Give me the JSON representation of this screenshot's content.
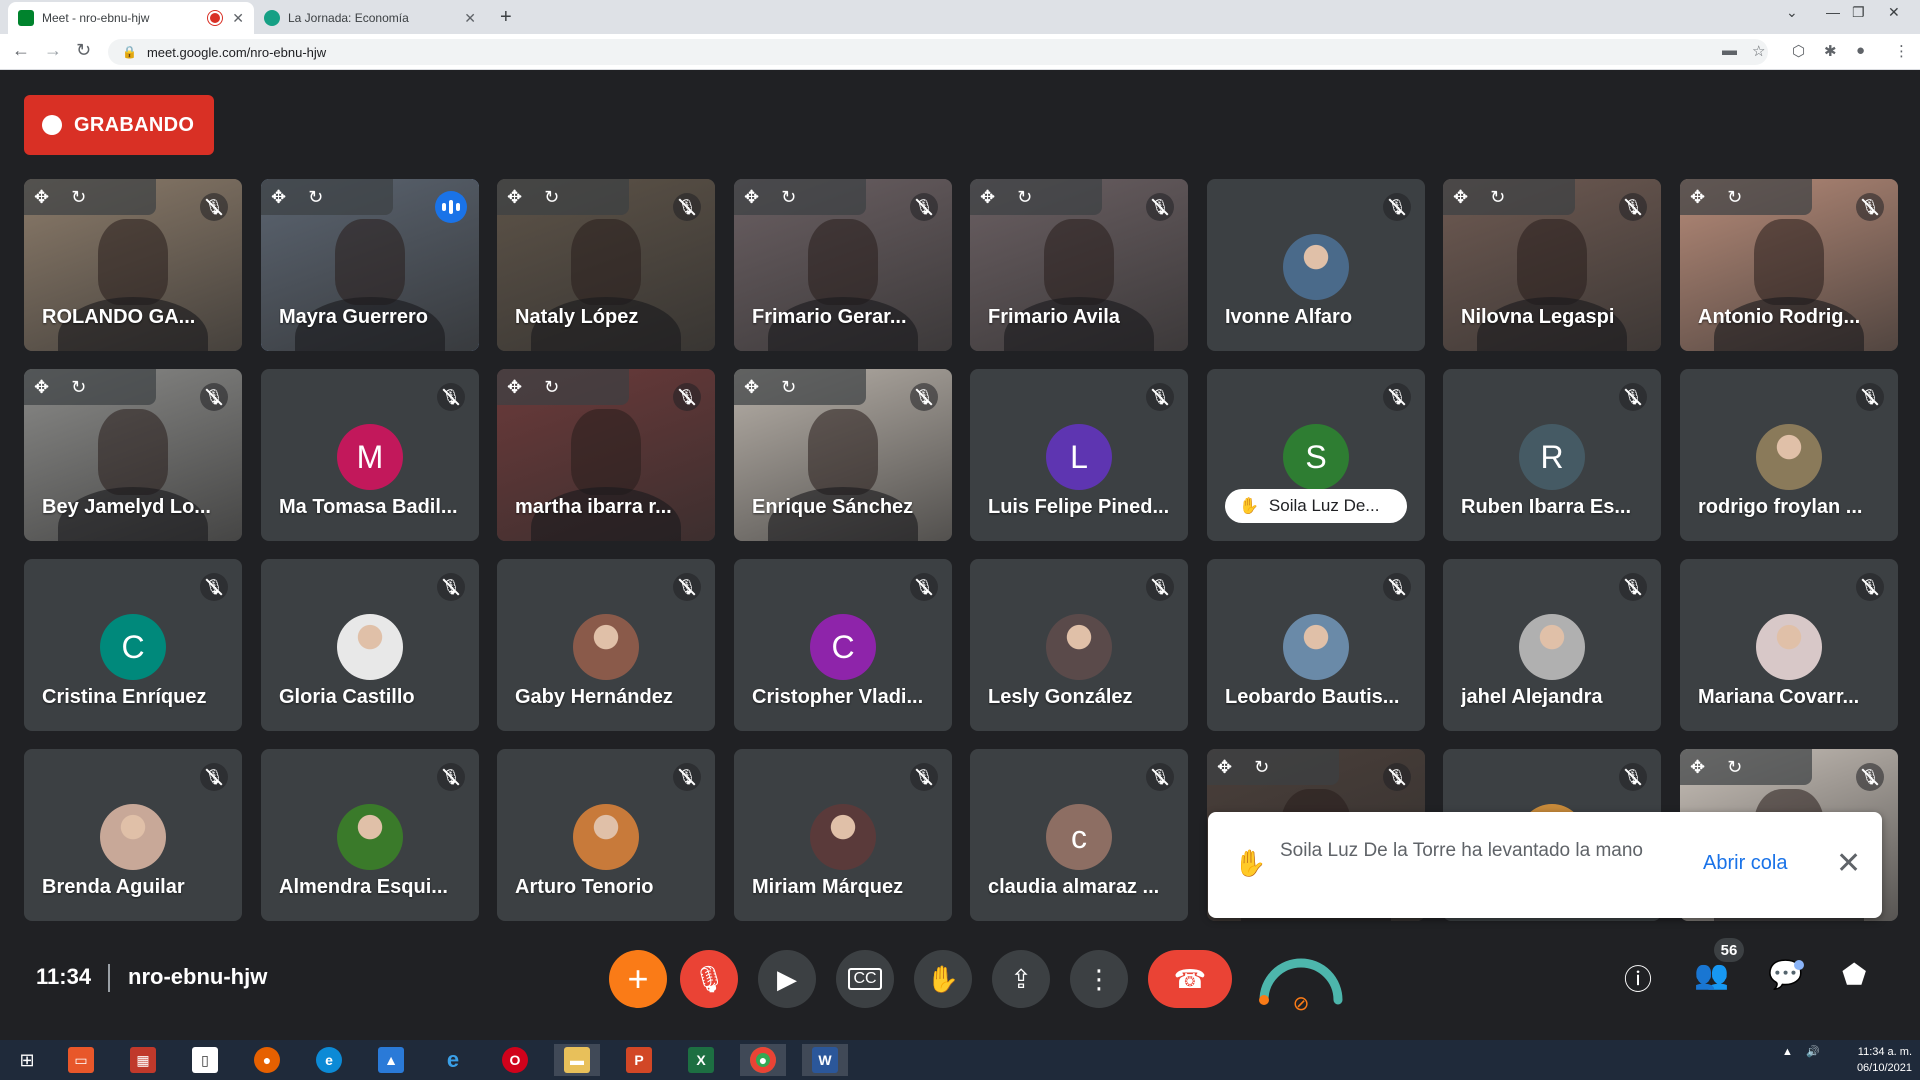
{
  "browser": {
    "tabs": [
      {
        "title": "Meet - nro-ebnu-hjw",
        "active": true,
        "favicon_color": "#00832d"
      },
      {
        "title": "La Jornada: Economía",
        "active": false,
        "favicon_color": "#16a085"
      }
    ],
    "url": "meet.google.com/nro-ebnu-hjw"
  },
  "recording": {
    "label": "GRABANDO"
  },
  "participants": [
    {
      "name": "ROLANDO GA...",
      "type": "video",
      "bg": "#8b7b6a",
      "speaking": false,
      "controls": true
    },
    {
      "name": "Mayra Guerrero",
      "type": "video",
      "bg": "#5b6470",
      "speaking": true,
      "controls": true
    },
    {
      "name": "Nataly López",
      "type": "video",
      "bg": "#5d5348",
      "speaking": false,
      "controls": true
    },
    {
      "name": "Frimario Gerar...",
      "type": "video",
      "bg": "#6a5f62",
      "speaking": false,
      "controls": true
    },
    {
      "name": "Frimario Avila",
      "type": "video",
      "bg": "#6a5f62",
      "speaking": false,
      "controls": true
    },
    {
      "name": "Ivonne Alfaro",
      "type": "photo",
      "avatar_color": "#4a6a8a",
      "speaking": false
    },
    {
      "name": "Nilovna Legaspi",
      "type": "video",
      "bg": "#6e5a52",
      "speaking": false,
      "controls": true
    },
    {
      "name": "Antonio Rodrig...",
      "type": "video",
      "bg": "#b58a78",
      "speaking": false,
      "controls": true
    },
    {
      "name": "Bey Jamelyd Lo...",
      "type": "video",
      "bg": "#8a8a88",
      "speaking": false,
      "controls": true
    },
    {
      "name": "Ma Tomasa Badil...",
      "type": "letter",
      "letter": "M",
      "avatar_color": "#c2185b",
      "speaking": false
    },
    {
      "name": "martha ibarra r...",
      "type": "video",
      "bg": "#6b3a3a",
      "speaking": false,
      "controls": true
    },
    {
      "name": "Enrique Sánchez",
      "type": "video",
      "bg": "#b7b0a8",
      "speaking": false,
      "controls": true
    },
    {
      "name": "Luis Felipe Pined...",
      "type": "letter",
      "letter": "L",
      "avatar_color": "#5e35b1",
      "speaking": false
    },
    {
      "name": "Soila Luz De...",
      "type": "letter",
      "letter": "S",
      "avatar_color": "#2e7d32",
      "speaking": false,
      "hand_raised": true
    },
    {
      "name": "Ruben Ibarra Es...",
      "type": "letter",
      "letter": "R",
      "avatar_color": "#455a64",
      "speaking": false
    },
    {
      "name": "rodrigo froylan ...",
      "type": "photo",
      "avatar_color": "#8a7a5a",
      "speaking": false
    },
    {
      "name": "Cristina Enríquez",
      "type": "letter",
      "letter": "C",
      "avatar_color": "#00897b",
      "speaking": false
    },
    {
      "name": "Gloria Castillo",
      "type": "photo",
      "avatar_color": "#e8e8e8",
      "speaking": false
    },
    {
      "name": "Gaby Hernández",
      "type": "photo",
      "avatar_color": "#8a5a4a",
      "speaking": false
    },
    {
      "name": "Cristopher Vladi...",
      "type": "letter",
      "letter": "C",
      "avatar_color": "#8e24aa",
      "speaking": false
    },
    {
      "name": "Lesly González",
      "type": "photo",
      "avatar_color": "#5a4a4a",
      "speaking": false
    },
    {
      "name": "Leobardo Bautis...",
      "type": "photo",
      "avatar_color": "#6a8aa8",
      "speaking": false
    },
    {
      "name": "jahel Alejandra",
      "type": "photo",
      "avatar_color": "#b0b0b0",
      "speaking": false
    },
    {
      "name": "Mariana Covarr...",
      "type": "photo",
      "avatar_color": "#d8c8c8",
      "speaking": false
    },
    {
      "name": "Brenda Aguilar",
      "type": "photo",
      "avatar_color": "#c8a898",
      "speaking": false
    },
    {
      "name": "Almendra Esqui...",
      "type": "photo",
      "avatar_color": "#3a7a2a",
      "speaking": false
    },
    {
      "name": "Arturo Tenorio",
      "type": "photo",
      "avatar_color": "#c87a3a",
      "speaking": false
    },
    {
      "name": "Miriam Márquez",
      "type": "photo",
      "avatar_color": "#5a3a3a",
      "speaking": false
    },
    {
      "name": "claudia almaraz ...",
      "type": "letter",
      "letter": "c",
      "avatar_color": "#8d6e63",
      "speaking": false
    },
    {
      "name": "",
      "type": "video",
      "bg": "#4a3f3a",
      "speaking": false,
      "controls": true
    },
    {
      "name": "",
      "type": "photo",
      "avatar_color": "#c88a3a",
      "speaking": false
    },
    {
      "name": "",
      "type": "video",
      "bg": "#c8c0b8",
      "speaking": false,
      "controls": true
    }
  ],
  "toast": {
    "message": "Soila Luz De la Torre ha levantado la mano",
    "action": "Abrir cola"
  },
  "bottombar": {
    "time": "11:34",
    "meeting_code": "nro-ebnu-hjw",
    "participant_count": "56"
  },
  "taskbar": {
    "time": "11:34 a. m.",
    "date": "06/10/2021"
  }
}
